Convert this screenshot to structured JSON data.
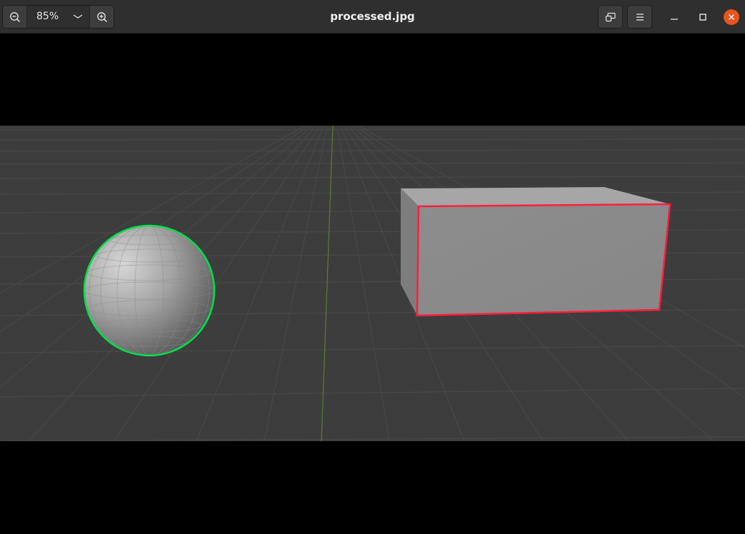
{
  "window": {
    "title": "processed.jpg",
    "zoom_level": "85%"
  },
  "icons": {
    "zoom_out": "zoom-out-icon",
    "zoom_in": "zoom-in-icon",
    "zoom_dropdown": "chevron-down-icon",
    "fullscreen": "fullscreen-icon",
    "menu": "hamburger-menu-icon",
    "minimize": "minimize-icon",
    "maximize": "maximize-icon",
    "close": "close-icon"
  },
  "colors": {
    "titlebar": "#2f2f2f",
    "close_button": "#e95420",
    "sphere_outline": "#00e04a",
    "box_outline": "#ff1e3c",
    "viewport_background": "#3d3d3d"
  }
}
